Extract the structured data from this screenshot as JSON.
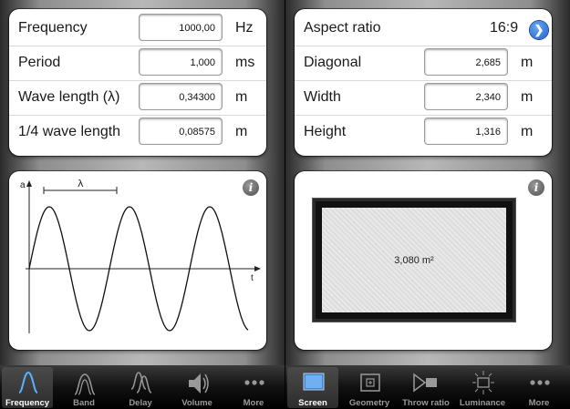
{
  "frequency_screen": {
    "rows": [
      {
        "label": "Frequency",
        "value": "1000,00",
        "unit": "Hz"
      },
      {
        "label": "Period",
        "value": "1,000",
        "unit": "ms"
      },
      {
        "label": "Wave length (λ)",
        "value": "0,34300",
        "unit": "m"
      },
      {
        "label": "1/4 wave length",
        "value": "0,08575",
        "unit": "m"
      }
    ],
    "graph": {
      "y_axis_label": "a",
      "x_axis_label": "t",
      "wavelength_label": "λ"
    },
    "info_icon": "i",
    "tabs": [
      {
        "label": "Frequency",
        "icon": "sine-wave-icon",
        "active": true
      },
      {
        "label": "Band",
        "icon": "band-filter-icon",
        "active": false
      },
      {
        "label": "Delay",
        "icon": "delay-icon",
        "active": false
      },
      {
        "label": "Volume",
        "icon": "speaker-icon",
        "active": false
      },
      {
        "label": "More",
        "icon": "more-dots-icon",
        "active": false
      }
    ]
  },
  "screen_screen": {
    "aspect_ratio": {
      "label": "Aspect ratio",
      "value": "16:9"
    },
    "rows": [
      {
        "label": "Diagonal",
        "value": "2,685",
        "unit": "m"
      },
      {
        "label": "Width",
        "value": "2,340",
        "unit": "m"
      },
      {
        "label": "Height",
        "value": "1,316",
        "unit": "m"
      }
    ],
    "area": "3,080 m²",
    "info_icon": "i",
    "tabs": [
      {
        "label": "Screen",
        "icon": "screen-icon",
        "active": true
      },
      {
        "label": "Geometry",
        "icon": "geometry-icon",
        "active": false
      },
      {
        "label": "Throw ratio",
        "icon": "projector-icon",
        "active": false
      },
      {
        "label": "Luminance",
        "icon": "luminance-icon",
        "active": false
      },
      {
        "label": "More",
        "icon": "more-dots-icon",
        "active": false
      }
    ]
  },
  "colors": {
    "accent_blue": "#2f7de0",
    "tab_active": "#ffffff",
    "tab_inactive": "#9a9a9a"
  }
}
